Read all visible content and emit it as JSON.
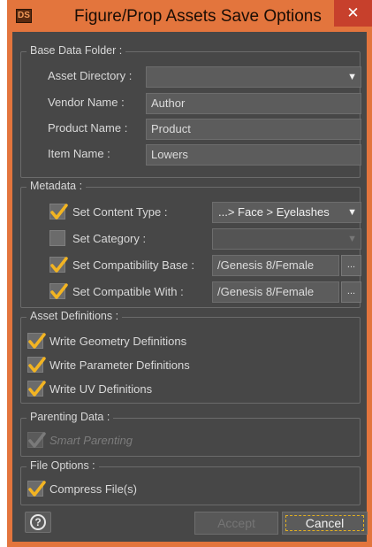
{
  "window": {
    "logo_text": "DS",
    "title": "Figure/Prop Assets Save Options",
    "close_glyph": "✕",
    "accent_color": "#e3753d",
    "close_color": "#c7402c"
  },
  "base_data": {
    "legend": "Base Data Folder :",
    "asset_directory": {
      "label": "Asset Directory :",
      "value": ""
    },
    "vendor_name": {
      "label": "Vendor Name :",
      "value": "Author"
    },
    "product_name": {
      "label": "Product Name :",
      "value": "Product"
    },
    "item_name": {
      "label": "Item Name :",
      "value": "Lowers"
    }
  },
  "metadata": {
    "legend": "Metadata :",
    "content_type": {
      "label": "Set Content Type :",
      "checked": true,
      "value": "...> Face > Eyelashes"
    },
    "category": {
      "label": "Set Category :",
      "checked": false,
      "value": ""
    },
    "compat_base": {
      "label": "Set Compatibility Base :",
      "checked": true,
      "value": "/Genesis 8/Female",
      "button": "..."
    },
    "compat_with": {
      "label": "Set Compatible With :",
      "checked": true,
      "value": "/Genesis 8/Female",
      "button": "..."
    }
  },
  "asset_definitions": {
    "legend": "Asset Definitions :",
    "geometry": {
      "label": "Write Geometry Definitions",
      "checked": true
    },
    "parameter": {
      "label": "Write Parameter Definitions",
      "checked": true
    },
    "uv": {
      "label": "Write UV Definitions",
      "checked": true
    }
  },
  "parenting": {
    "legend": "Parenting Data :",
    "smart_parenting": {
      "label": "Smart Parenting",
      "checked": true,
      "enabled": false
    }
  },
  "file_options": {
    "legend": "File Options :",
    "compress": {
      "label": "Compress File(s)",
      "checked": true
    }
  },
  "footer": {
    "help_glyph": "?",
    "accept_label": "Accept",
    "cancel_label": "Cancel"
  },
  "icons": {
    "checkmark": "checkmark-icon",
    "dropdown": "chevron-down-icon",
    "help": "help-icon"
  }
}
